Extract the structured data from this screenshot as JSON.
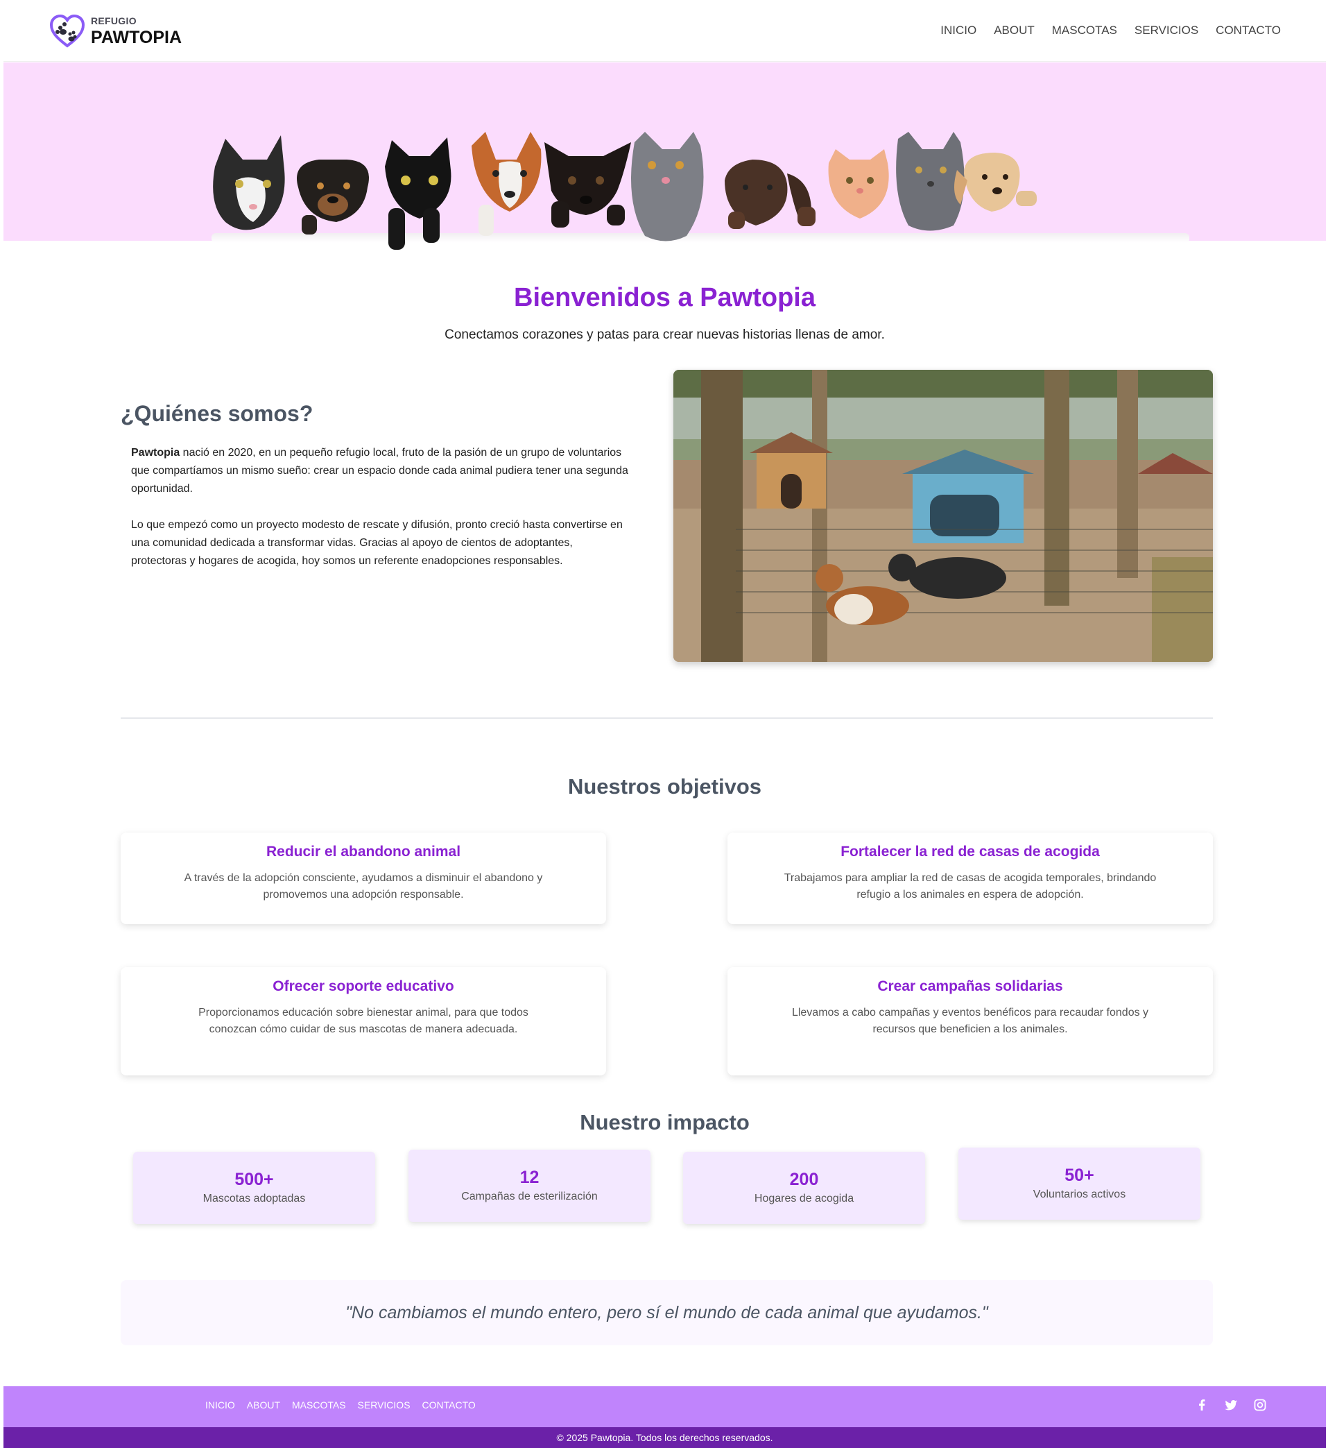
{
  "header": {
    "logo_small": "REFUGIO",
    "logo_big": "PAWTOPIA",
    "nav": [
      "INICIO",
      "ABOUT",
      "MASCOTAS",
      "SERVICIOS",
      "CONTACTO"
    ]
  },
  "hero": {
    "title": "Bienvenidos a Pawtopia",
    "subtitle": "Conectamos corazones y patas para crear nuevas historias llenas de amor."
  },
  "about": {
    "title": "¿Quiénes somos?",
    "brand": "Pawtopia",
    "p1_rest": " nació en 2020, en un pequeño refugio local, fruto de la pasión de un grupo de voluntarios que compartíamos un mismo sueño: crear un espacio donde cada animal pudiera tener una segunda oportunidad.",
    "p2": "Lo que empezó como un proyecto modesto de rescate y difusión, pronto creció hasta convertirse en una comunidad dedicada a transformar vidas. Gracias al apoyo de cientos de adoptantes, protectoras y hogares de acogida, hoy somos un referente enadopciones responsables."
  },
  "objectives": {
    "title": "Nuestros objetivos",
    "items": [
      {
        "title": "Reducir el abandono animal",
        "text": "A través de la adopción consciente, ayudamos a disminuir el abandono y promovemos una adopción responsable."
      },
      {
        "title": "Fortalecer la red de casas de acogida",
        "text": "Trabajamos para ampliar la red de casas de acogida temporales, brindando refugio a los animales en espera de adopción."
      },
      {
        "title": "Ofrecer soporte educativo",
        "text": "Proporcionamos educación sobre bienestar animal, para que todos conozcan cómo cuidar de sus mascotas de manera adecuada."
      },
      {
        "title": "Crear campañas solidarias",
        "text": "Llevamos a cabo campañas y eventos benéficos para recaudar fondos y recursos que beneficien a los animales."
      }
    ]
  },
  "impact": {
    "title": "Nuestro impacto",
    "stats": [
      {
        "num": "500+",
        "label": "Mascotas adoptadas"
      },
      {
        "num": "12",
        "label": "Campañas de esterilización"
      },
      {
        "num": "200",
        "label": "Hogares de acogida"
      },
      {
        "num": "50+",
        "label": "Voluntarios activos"
      }
    ]
  },
  "quote": "\"No cambiamos el mundo entero, pero sí el mundo de cada animal que ayudamos.\"",
  "footer": {
    "nav": [
      "INICIO",
      "ABOUT",
      "MASCOTAS",
      "SERVICIOS",
      "CONTACTO"
    ],
    "social": [
      "facebook-icon",
      "twitter-icon",
      "instagram-icon"
    ],
    "copyright": "© 2025 Pawtopia. Todos los derechos reservados."
  },
  "colors": {
    "accent": "#8a22d2",
    "hero_band": "#fbdcfd",
    "footer_top": "#c084fc",
    "footer_bottom": "#6b21a8",
    "stat_bg": "#f3e8ff"
  }
}
